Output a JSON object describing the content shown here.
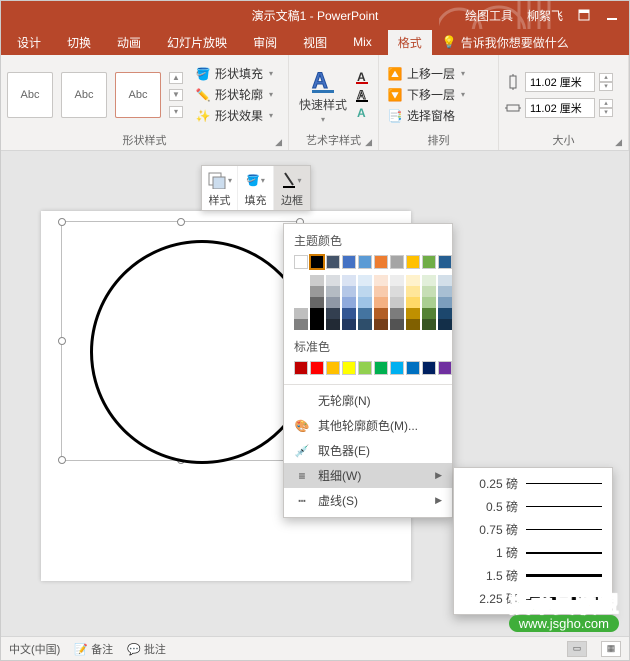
{
  "title": {
    "app": "演示文稿1 - PowerPoint",
    "context_tab": "绘图工具",
    "user": "柳絮飞"
  },
  "tabs": {
    "design": "设计",
    "transition": "切换",
    "animation": "动画",
    "slideshow": "幻灯片放映",
    "review": "审阅",
    "view": "视图",
    "mix": "Mix",
    "format": "格式",
    "tell_me": "告诉我你想要做什么"
  },
  "ribbon": {
    "shape_styles": {
      "label": "形状样式",
      "thumb": "Abc",
      "fill": "形状填充",
      "outline": "形状轮廓",
      "effects": "形状效果"
    },
    "wordart": {
      "label": "艺术字样式",
      "quick": "快速样式"
    },
    "arrange": {
      "label": "排列",
      "bring_forward": "上移一层",
      "send_backward": "下移一层",
      "selection_pane": "选择窗格"
    },
    "size": {
      "label": "大小",
      "h": "11.02 厘米",
      "w": "11.02 厘米"
    }
  },
  "mini": {
    "style": "样式",
    "fill": "填充",
    "outline": "边框"
  },
  "outline_menu": {
    "theme": "主题颜色",
    "standard": "标准色",
    "no_outline": "无轮廓(N)",
    "more_colors": "其他轮廓颜色(M)...",
    "eyedropper": "取色器(E)",
    "weight": "粗细(W)",
    "dashes": "虚线(S)",
    "theme_row": [
      "#ffffff",
      "#000000",
      "#44546a",
      "#4472c4",
      "#5b9bd5",
      "#ed7d31",
      "#a5a5a5",
      "#ffc000",
      "#70ad47",
      "#255e91"
    ],
    "standard_row": [
      "#c00000",
      "#ff0000",
      "#ffc000",
      "#ffff00",
      "#92d050",
      "#00b050",
      "#00b0f0",
      "#0070c0",
      "#002060",
      "#7030a0"
    ]
  },
  "weights": [
    "0.25 磅",
    "0.5 磅",
    "0.75 磅",
    "1 磅",
    "1.5 磅",
    "2.25 磅"
  ],
  "status": {
    "lang": "中文(中国)",
    "notes": "备注",
    "comments": "批注"
  },
  "watermark": {
    "line1_a": "技术员",
    "line1_b": "联盟",
    "line2": "www.jsgho.com"
  }
}
